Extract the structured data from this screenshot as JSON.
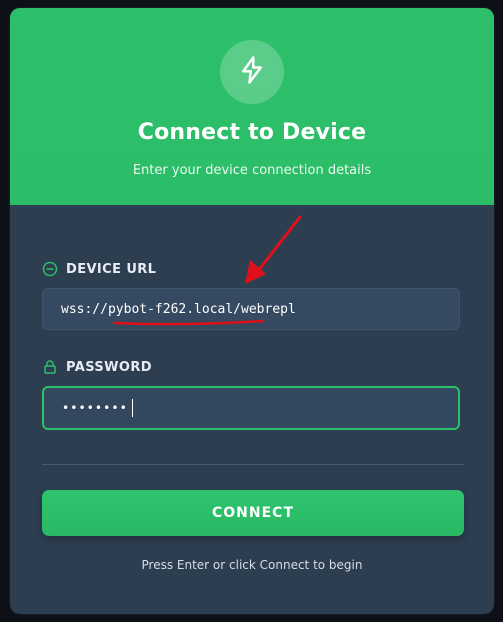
{
  "header": {
    "title": "Connect to Device",
    "subtitle": "Enter your device connection details",
    "icon": "lightning-bolt-icon"
  },
  "form": {
    "url_label": "DEVICE URL",
    "url_icon": "minus-circle-icon",
    "url_value": "wss://pybot-f262.local/webrepl",
    "password_label": "PASSWORD",
    "password_icon": "lock-icon",
    "password_masked": "••••••••"
  },
  "actions": {
    "connect_label": "CONNECT",
    "hint": "Press Enter or click Connect to begin"
  },
  "colors": {
    "accent": "#2ebf6a",
    "card_bg": "#2c3e50",
    "input_bg": "#354a61",
    "annotation": "#e0101a"
  }
}
